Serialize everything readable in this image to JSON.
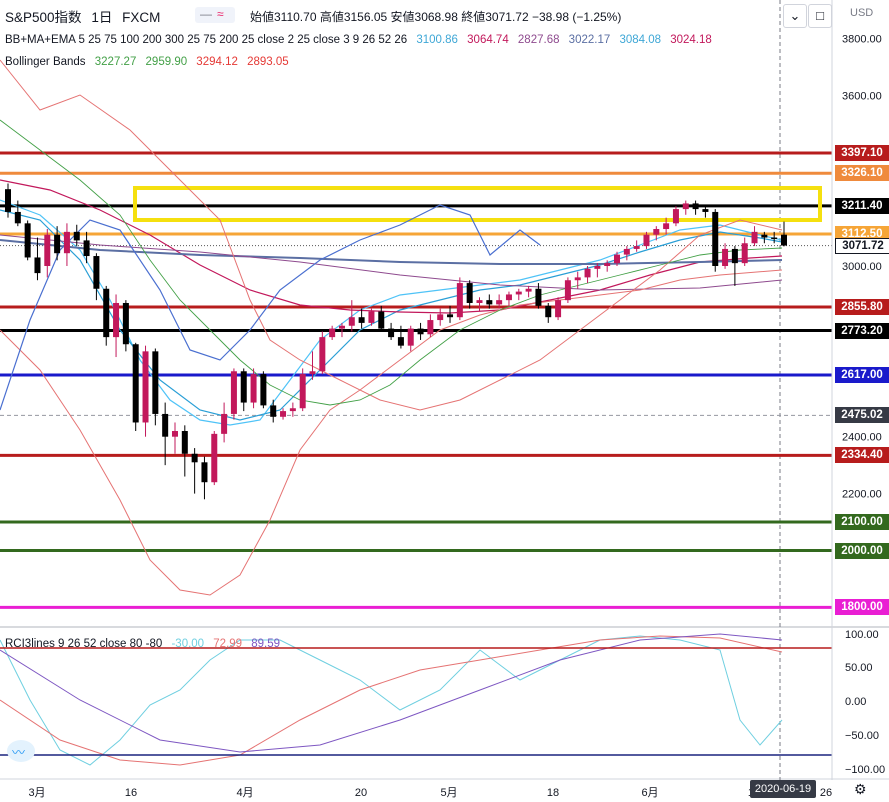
{
  "header": {
    "symbol": "S&P500指数",
    "interval": "1日",
    "source": "FXCM",
    "ohlc": "始値3110.70 高値3156.05 安値3068.98 終値3071.72 −38.98 (−1.25%)",
    "currency": "USD"
  },
  "indicators": [
    {
      "label": "BB+MA+EMA 5 25 75 100 200 300 25 75 200 25 close 2 25 close 3 9 26 52 26",
      "values": [
        "3100.86",
        "3064.74",
        "2827.68",
        "3022.17",
        "3084.08",
        "3024.18"
      ],
      "value_colors": [
        "#3ea7d6",
        "#c2185b",
        "#8e4a8e",
        "#5b6fa3",
        "#3ea7d6",
        "#c2185b"
      ]
    },
    {
      "label": "Bollinger Bands",
      "values": [
        "3227.27",
        "2959.90",
        "3294.12",
        "2893.05"
      ],
      "value_colors": [
        "#43a047",
        "#43a047",
        "#e53935",
        "#e53935"
      ]
    }
  ],
  "rci_label": {
    "label": "RCI3lines 9 26 52 close 80 -80",
    "values": [
      "-30.00",
      "72.99",
      "89.59"
    ],
    "value_colors": [
      "#6fcfe0",
      "#e57373",
      "#7e57c2"
    ]
  },
  "date_footer": "2020-06-19",
  "chart_data": {
    "type": "candlestick",
    "ylim": [
      1750,
      3880
    ],
    "price_axis_ticks": [
      3800,
      3600,
      3400,
      3200,
      3000,
      2400,
      2200,
      2000
    ],
    "x_tick_labels": [
      "3月",
      "16",
      "4月",
      "20",
      "5月",
      "18",
      "6月",
      "15",
      "26"
    ],
    "current_price": 3071.72,
    "crosshair_price": 2475.02,
    "horizontal_lines": [
      {
        "price": 3397.1,
        "color": "#b71c1c"
      },
      {
        "price": 3326.1,
        "color": "#ef8a3c"
      },
      {
        "price": 3211.4,
        "color": "#000000"
      },
      {
        "price": 3112.5,
        "color": "#f6a537"
      },
      {
        "price": 2855.8,
        "color": "#b71c1c"
      },
      {
        "price": 2773.2,
        "color": "#000000"
      },
      {
        "price": 2617.0,
        "color": "#1a1acb"
      },
      {
        "price": 2334.4,
        "color": "#b71c1c"
      },
      {
        "price": 2100.0,
        "color": "#33691e"
      },
      {
        "price": 2000.0,
        "color": "#33691e"
      },
      {
        "price": 1800.0,
        "color": "#e91ed3"
      }
    ],
    "candles": [
      [
        3270,
        3290,
        3170,
        3190
      ],
      [
        3190,
        3230,
        3140,
        3150
      ],
      [
        3150,
        3160,
        3020,
        3030
      ],
      [
        3030,
        3100,
        2950,
        2975
      ],
      [
        3000,
        3130,
        2960,
        3110
      ],
      [
        3110,
        3140,
        3020,
        3045
      ],
      [
        3045,
        3150,
        3000,
        3120
      ],
      [
        3120,
        3145,
        3070,
        3090
      ],
      [
        3090,
        3120,
        3010,
        3035
      ],
      [
        3035,
        3045,
        2880,
        2920
      ],
      [
        2920,
        2930,
        2720,
        2750
      ],
      [
        2750,
        2900,
        2680,
        2870
      ],
      [
        2870,
        2880,
        2700,
        2725
      ],
      [
        2725,
        2730,
        2420,
        2450
      ],
      [
        2450,
        2720,
        2400,
        2700
      ],
      [
        2700,
        2710,
        2440,
        2480
      ],
      [
        2480,
        2520,
        2300,
        2400
      ],
      [
        2400,
        2450,
        2340,
        2420
      ],
      [
        2420,
        2440,
        2260,
        2340
      ],
      [
        2340,
        2360,
        2200,
        2310
      ],
      [
        2310,
        2330,
        2180,
        2240
      ],
      [
        2240,
        2420,
        2230,
        2410
      ],
      [
        2410,
        2520,
        2380,
        2480
      ],
      [
        2480,
        2640,
        2460,
        2630
      ],
      [
        2630,
        2640,
        2490,
        2520
      ],
      [
        2520,
        2640,
        2500,
        2620
      ],
      [
        2620,
        2630,
        2500,
        2510
      ],
      [
        2510,
        2530,
        2450,
        2470
      ],
      [
        2470,
        2500,
        2460,
        2490
      ],
      [
        2490,
        2520,
        2470,
        2500
      ],
      [
        2500,
        2640,
        2490,
        2620
      ],
      [
        2620,
        2700,
        2600,
        2630
      ],
      [
        2630,
        2770,
        2620,
        2750
      ],
      [
        2750,
        2790,
        2740,
        2780
      ],
      [
        2780,
        2800,
        2750,
        2790
      ],
      [
        2790,
        2880,
        2770,
        2820
      ],
      [
        2820,
        2850,
        2780,
        2800
      ],
      [
        2800,
        2850,
        2790,
        2840
      ],
      [
        2840,
        2860,
        2770,
        2780
      ],
      [
        2780,
        2800,
        2740,
        2750
      ],
      [
        2750,
        2790,
        2710,
        2720
      ],
      [
        2720,
        2790,
        2700,
        2780
      ],
      [
        2780,
        2800,
        2740,
        2760
      ],
      [
        2760,
        2830,
        2750,
        2810
      ],
      [
        2810,
        2850,
        2790,
        2830
      ],
      [
        2830,
        2860,
        2800,
        2820
      ],
      [
        2820,
        2960,
        2810,
        2940
      ],
      [
        2940,
        2950,
        2850,
        2870
      ],
      [
        2870,
        2890,
        2840,
        2880
      ],
      [
        2880,
        2900,
        2850,
        2865
      ],
      [
        2865,
        2900,
        2850,
        2880
      ],
      [
        2880,
        2910,
        2860,
        2900
      ],
      [
        2900,
        2920,
        2880,
        2910
      ],
      [
        2910,
        2930,
        2890,
        2920
      ],
      [
        2920,
        2940,
        2850,
        2860
      ],
      [
        2860,
        2870,
        2800,
        2820
      ],
      [
        2820,
        2890,
        2810,
        2880
      ],
      [
        2880,
        2960,
        2870,
        2950
      ],
      [
        2950,
        2980,
        2920,
        2960
      ],
      [
        2960,
        3000,
        2940,
        2990
      ],
      [
        2990,
        3010,
        2960,
        3000
      ],
      [
        3000,
        3020,
        2980,
        3010
      ],
      [
        3010,
        3050,
        3000,
        3040
      ],
      [
        3040,
        3070,
        3020,
        3060
      ],
      [
        3060,
        3090,
        3050,
        3070
      ],
      [
        3070,
        3120,
        3060,
        3110
      ],
      [
        3110,
        3140,
        3090,
        3130
      ],
      [
        3130,
        3170,
        3110,
        3150
      ],
      [
        3150,
        3210,
        3140,
        3200
      ],
      [
        3200,
        3230,
        3180,
        3220
      ],
      [
        3220,
        3230,
        3180,
        3200
      ],
      [
        3200,
        3210,
        3170,
        3190
      ],
      [
        3190,
        3200,
        2980,
        3000
      ],
      [
        3000,
        3080,
        2990,
        3060
      ],
      [
        3060,
        3070,
        2930,
        3010
      ],
      [
        3010,
        3100,
        3000,
        3080
      ],
      [
        3080,
        3140,
        3070,
        3120
      ],
      [
        3110,
        3120,
        3080,
        3100
      ],
      [
        3100,
        3120,
        3080,
        3095
      ],
      [
        3110,
        3156,
        3069,
        3072
      ]
    ]
  }
}
